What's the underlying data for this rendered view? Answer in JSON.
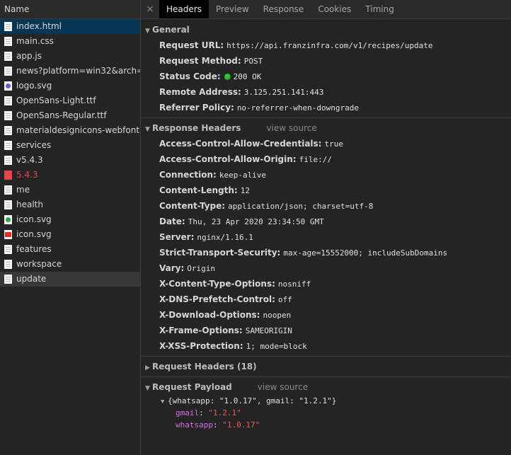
{
  "left_panel": {
    "header": "Name",
    "files": [
      {
        "name": "index.html",
        "icon": "document-icon",
        "state": "selected"
      },
      {
        "name": "main.css",
        "icon": "document-icon"
      },
      {
        "name": "app.js",
        "icon": "document-icon"
      },
      {
        "name": "news?platform=win32&arch=x...",
        "icon": "document-icon"
      },
      {
        "name": "logo.svg",
        "icon": "image-icon"
      },
      {
        "name": "OpenSans-Light.ttf",
        "icon": "document-icon"
      },
      {
        "name": "OpenSans-Regular.ttf",
        "icon": "document-icon"
      },
      {
        "name": "materialdesignicons-webfont...",
        "icon": "document-icon"
      },
      {
        "name": "services",
        "icon": "document-icon"
      },
      {
        "name": "v5.4.3",
        "icon": "document-icon"
      },
      {
        "name": "5.4.3",
        "icon": "error-document-icon",
        "state": "error"
      },
      {
        "name": "me",
        "icon": "document-icon"
      },
      {
        "name": "health",
        "icon": "document-icon"
      },
      {
        "name": "icon.svg",
        "icon": "whatsapp-icon"
      },
      {
        "name": "icon.svg",
        "icon": "gmail-icon"
      },
      {
        "name": "features",
        "icon": "document-icon"
      },
      {
        "name": "workspace",
        "icon": "document-icon"
      },
      {
        "name": "update",
        "icon": "document-icon",
        "state": "selected-dim"
      }
    ]
  },
  "tabs": {
    "close": "×",
    "items": [
      "Headers",
      "Preview",
      "Response",
      "Cookies",
      "Timing"
    ],
    "active": "Headers"
  },
  "general": {
    "title": "General",
    "rows": [
      {
        "key": "Request URL:",
        "value": "https://api.franzinfra.com/v1/recipes/update"
      },
      {
        "key": "Request Method:",
        "value": "POST"
      },
      {
        "key": "Status Code:",
        "value": "200 OK"
      },
      {
        "key": "Remote Address:",
        "value": "3.125.251.141:443"
      },
      {
        "key": "Referrer Policy:",
        "value": "no-referrer-when-downgrade"
      }
    ]
  },
  "response_headers": {
    "title": "Response Headers",
    "view_source": "view source",
    "rows": [
      {
        "key": "Access-Control-Allow-Credentials:",
        "value": "true"
      },
      {
        "key": "Access-Control-Allow-Origin:",
        "value": "file://"
      },
      {
        "key": "Connection:",
        "value": "keep-alive"
      },
      {
        "key": "Content-Length:",
        "value": "12"
      },
      {
        "key": "Content-Type:",
        "value": "application/json; charset=utf-8"
      },
      {
        "key": "Date:",
        "value": "Thu, 23 Apr 2020 23:34:50 GMT"
      },
      {
        "key": "Server:",
        "value": "nginx/1.16.1"
      },
      {
        "key": "Strict-Transport-Security:",
        "value": "max-age=15552000; includeSubDomains"
      },
      {
        "key": "Vary:",
        "value": "Origin"
      },
      {
        "key": "X-Content-Type-Options:",
        "value": "nosniff"
      },
      {
        "key": "X-DNS-Prefetch-Control:",
        "value": "off"
      },
      {
        "key": "X-Download-Options:",
        "value": "noopen"
      },
      {
        "key": "X-Frame-Options:",
        "value": "SAMEORIGIN"
      },
      {
        "key": "X-XSS-Protection:",
        "value": "1; mode=block"
      }
    ]
  },
  "request_headers": {
    "title": "Request Headers (18)"
  },
  "request_payload": {
    "title": "Request Payload",
    "view_source": "view source",
    "summary": "{whatsapp: \"1.0.17\", gmail: \"1.2.1\"}",
    "props": [
      {
        "key": "gmail",
        "value": "\"1.2.1\""
      },
      {
        "key": "whatsapp",
        "value": "\"1.0.17\""
      }
    ]
  },
  "colors": {
    "selected_row": "#073655",
    "error_text": "#e8444d",
    "status_ok": "#34c334",
    "payload_key": "#d36ee8",
    "payload_string": "#f05a5a"
  }
}
